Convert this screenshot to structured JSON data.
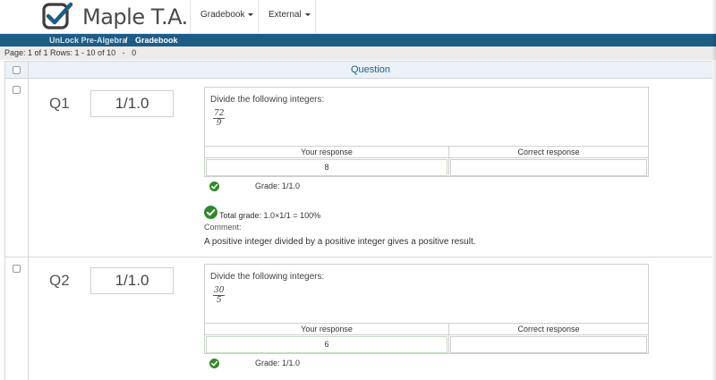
{
  "app": {
    "logo_text": "Maple T.A."
  },
  "nav": {
    "items": [
      {
        "label": "Gradebook"
      },
      {
        "label": "External"
      }
    ]
  },
  "breadcrumb": {
    "course": "UnLock Pre-Algebra",
    "separator": "/",
    "current": "Gradebook"
  },
  "pager": {
    "text": "Page: 1 of 1 Rows: 1 - 10 of 10   -   0"
  },
  "table": {
    "header": "Question"
  },
  "colors": {
    "brand_blue": "#1c5d87",
    "check_green": "#2f8a2a",
    "header_bg": "#ebf2f7"
  },
  "questions": [
    {
      "number": "Q1",
      "grade": "1/1.0",
      "prompt": "Divide the following integers:",
      "numerator": "72",
      "denominator": "9",
      "your_response_label": "Your response",
      "correct_response_label": "Correct response",
      "your_response": "8",
      "grade_line": "Grade: 1/1.0",
      "total_grade": "Total grade: 1.0×1/1 = 100%",
      "comment_label": "Comment:",
      "comment": "A positive integer divided by a positive integer gives a positive result."
    },
    {
      "number": "Q2",
      "grade": "1/1.0",
      "prompt": "Divide the following integers:",
      "numerator": "30",
      "denominator": "5",
      "your_response_label": "Your response",
      "correct_response_label": "Correct response",
      "your_response": "6",
      "grade_line": "Grade: 1/1.0"
    }
  ]
}
